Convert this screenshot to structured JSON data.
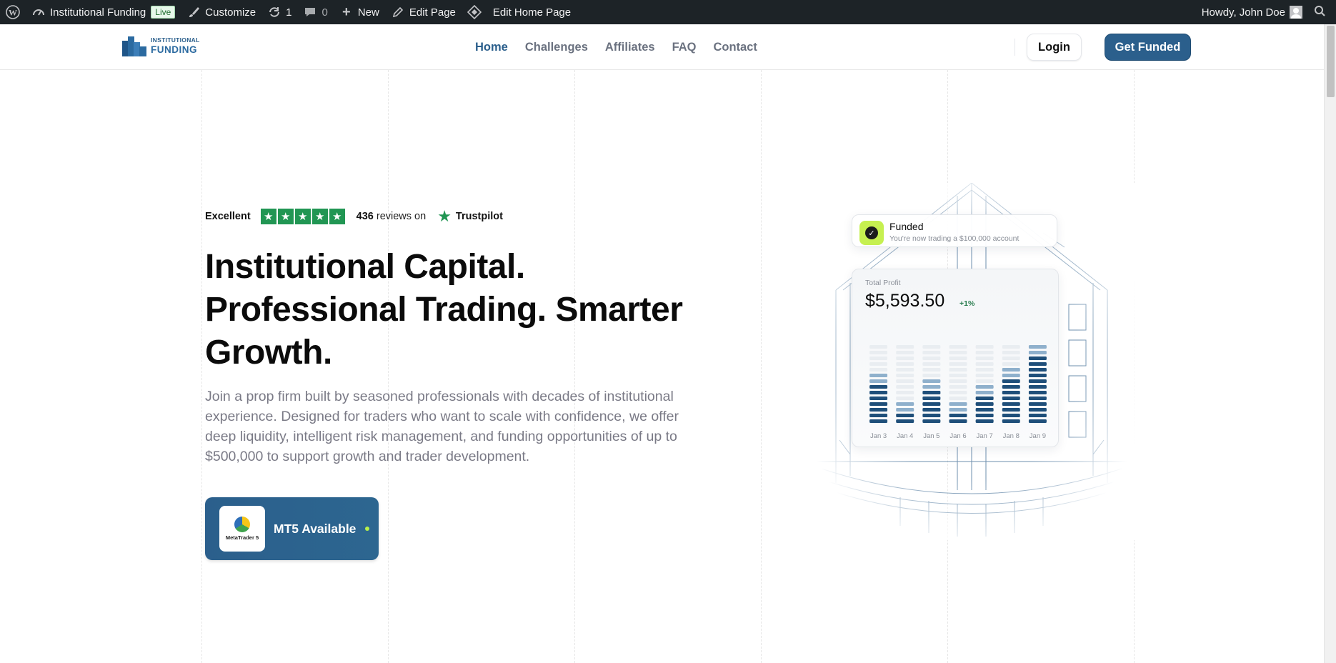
{
  "adminbar": {
    "site_name": "Institutional Funding",
    "live_badge": "Live",
    "customize": "Customize",
    "updates_count": "1",
    "comments_count": "0",
    "new": "New",
    "edit_page": "Edit Page",
    "edit_home_page": "Edit Home Page",
    "greeting": "Howdy, John Doe"
  },
  "header": {
    "logo_line1": "INSTITUTIONAL",
    "logo_line2": "FUNDING",
    "nav": [
      "Home",
      "Challenges",
      "Affiliates",
      "FAQ",
      "Contact"
    ],
    "active_nav": "Home",
    "login": "Login",
    "cta": "Get Funded",
    "brand_color": "#2b5f8c"
  },
  "hero": {
    "rating_word": "Excellent",
    "stars": 5,
    "review_count": "436",
    "reviews_text": "reviews on",
    "trust_brand": "Trustpilot",
    "title": "Institutional Capital. Professional Trading. Smarter Growth.",
    "subtitle": "Join a prop firm built by seasoned professionals with decades of institutional experience. Designed for traders who want to scale with confidence, we offer deep liquidity, intelligent risk management, and funding opportunities of up to $500,000 to support growth and trader development.",
    "platform_logo_caption": "MetaTrader 5",
    "platform_label": "MT5 Available",
    "accent_green": "#c6f050"
  },
  "funded_card": {
    "title": "Funded",
    "subtitle": "You're now trading a $100,000 account"
  },
  "profit_card": {
    "label": "Total Profit",
    "value": "$5,593.50",
    "change": "+1%"
  },
  "chart_data": {
    "type": "bar",
    "categories": [
      "Jan 3",
      "Jan 4",
      "Jan 5",
      "Jan 6",
      "Jan 7",
      "Jan 8",
      "Jan 9"
    ],
    "series": [
      {
        "values": [
          9,
          4,
          8,
          4,
          7,
          10,
          14
        ]
      }
    ],
    "ylim": [
      0,
      14
    ],
    "title": "",
    "xlabel": "",
    "ylabel": "",
    "grid": false
  }
}
